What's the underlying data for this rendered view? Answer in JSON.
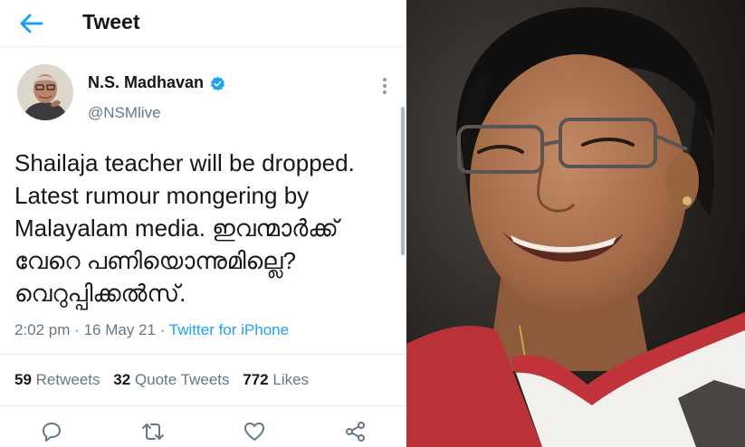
{
  "header": {
    "title": "Tweet"
  },
  "author": {
    "name": "N.S. Madhavan",
    "handle": "@NSMlive"
  },
  "tweet": {
    "text": "Shailaja teacher will be dropped.\nLatest rumour mongering by\nMalayalam media. ഇവന്മാർക്ക്\nവേറെ പണിയൊന്നുമില്ലെ?\nവെറുപ്പിക്കൽസ്."
  },
  "meta": {
    "time": "2:02 pm",
    "separator": "·",
    "date": "16 May 21",
    "client": "Twitter for iPhone"
  },
  "stats": {
    "retweets_count": "59",
    "retweets_label": "Retweets",
    "quotes_count": "32",
    "quotes_label": "Quote Tweets",
    "likes_count": "772",
    "likes_label": "Likes"
  },
  "colors": {
    "accent": "#1da1f2",
    "secondary_text": "#657786",
    "primary_text": "#14171a"
  },
  "icons": [
    "back-arrow-icon",
    "verified-badge-icon",
    "more-options-icon",
    "reply-icon",
    "retweet-icon",
    "like-icon",
    "share-icon"
  ]
}
